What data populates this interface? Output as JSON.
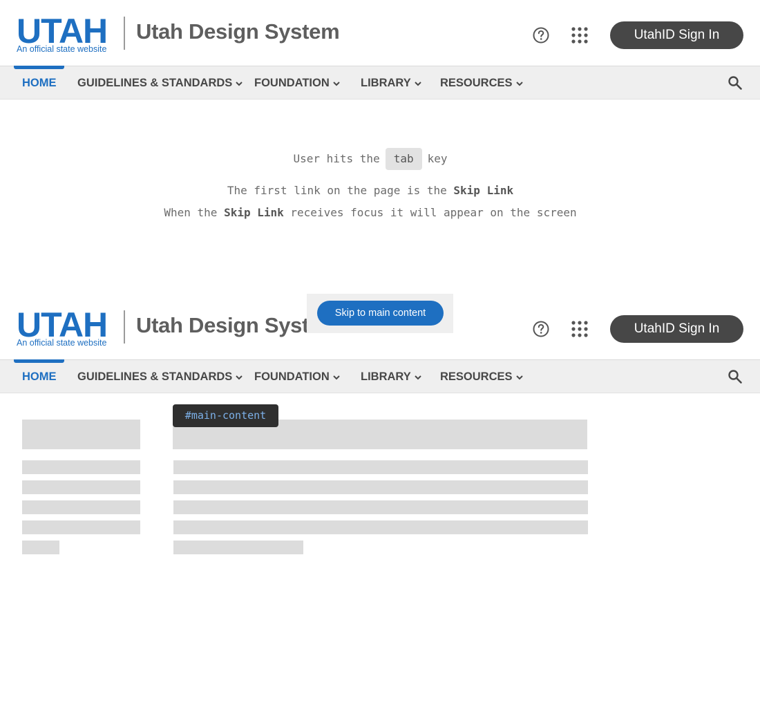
{
  "header": {
    "logo_word": "UTAH",
    "logo_tagline": "An official state website",
    "site_title": "Utah Design System",
    "signin_label": "UtahID Sign In"
  },
  "nav": {
    "items": [
      {
        "label": "HOME",
        "active": true
      },
      {
        "label": "GUIDELINES & STANDARDS",
        "active": false
      },
      {
        "label": "FOUNDATION",
        "active": false
      },
      {
        "label": "LIBRARY",
        "active": false
      },
      {
        "label": "RESOURCES",
        "active": false
      }
    ]
  },
  "instructions": {
    "line1_before": "User hits the",
    "line1_key": "tab",
    "line1_after": "key",
    "line2_before": "The first link on the page is the",
    "line2_strong": "Skip Link",
    "line3_before": "When the",
    "line3_strong": "Skip Link",
    "line3_after": "receives focus it will appear on the screen"
  },
  "skip_link": {
    "label": "Skip to main content"
  },
  "main_anchor": {
    "label": "#main-content"
  },
  "icons": {
    "help": "help-circle-icon",
    "apps": "apps-grid-icon",
    "search": "search-icon",
    "chevron": "chevron-down-icon"
  },
  "colors": {
    "brand_blue": "#1e6fc1",
    "signin_bg": "#474747",
    "nav_bg": "#efefef",
    "skeleton": "#dcdcdc",
    "anchor_bg": "#2f2f2f",
    "anchor_text": "#7cb0e8"
  }
}
